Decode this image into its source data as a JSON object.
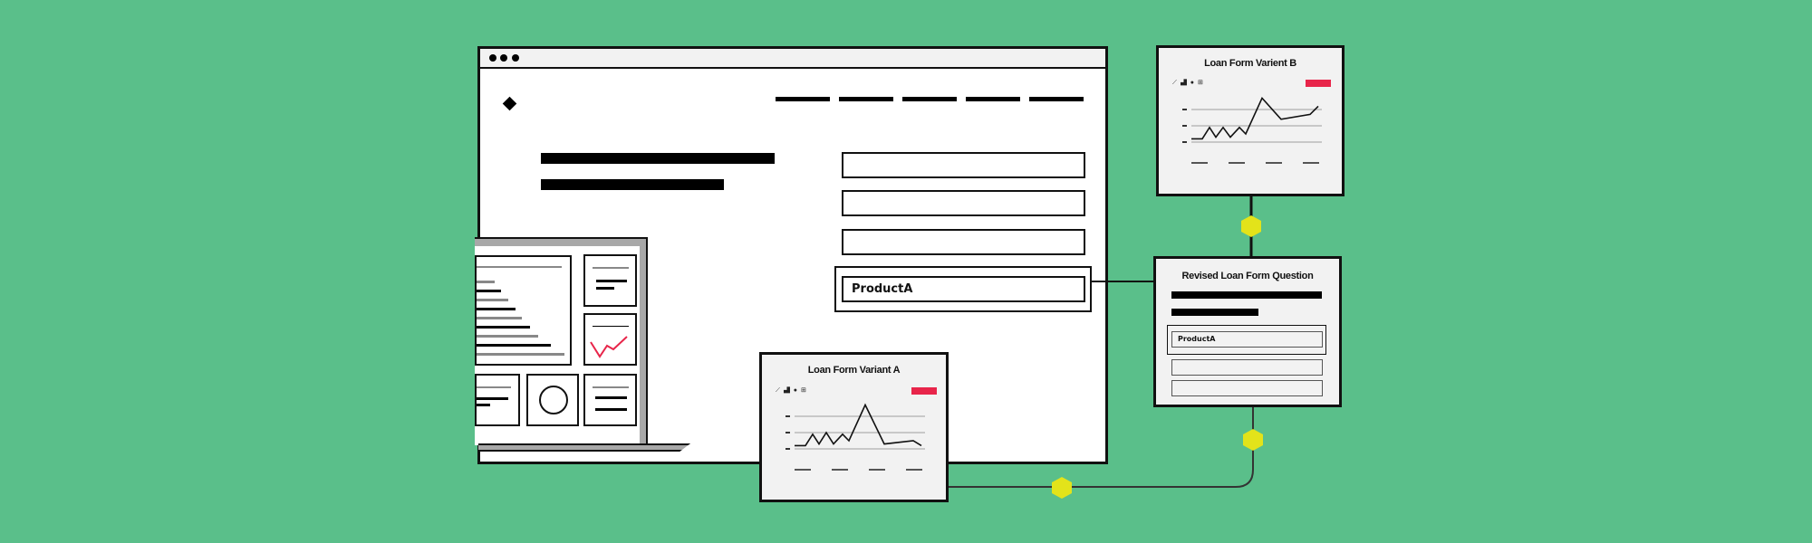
{
  "diagram": {
    "background_color": "#5ABF8A",
    "accent_red": "#E8254A",
    "connector_node_color": "#E3E31A",
    "browser_window": {
      "window_controls": [
        "dot",
        "dot",
        "dot"
      ],
      "logo_icon": "diamond-icon",
      "nav_item_count": 5,
      "form_fields": [
        {
          "value": ""
        },
        {
          "value": ""
        },
        {
          "value": ""
        },
        {
          "value": "ProductA",
          "highlighted": true
        }
      ]
    },
    "laptop_dashboard": {
      "icon": "laptop-dashboard-illustration"
    },
    "cards": {
      "variant_a": {
        "title": "Loan Form Variant A",
        "toolbar_icons": [
          "line-chart-icon",
          "bar-chart-icon",
          "pie-chart-icon",
          "grid-icon"
        ],
        "toolbar_glyphs": "⟋ ▟ ● ⊞"
      },
      "variant_b": {
        "title": "Loan Form Varient B",
        "toolbar_icons": [
          "line-chart-icon",
          "bar-chart-icon",
          "pie-chart-icon",
          "grid-icon"
        ],
        "toolbar_glyphs": "⟋ ▟ ● ⊞"
      },
      "revised": {
        "title": "Revised Loan Form Question",
        "fields": [
          {
            "value": "ProductA",
            "highlighted": true
          },
          {
            "value": ""
          },
          {
            "value": ""
          }
        ]
      }
    }
  },
  "chart_data": [
    {
      "type": "line",
      "title": "Loan Form Variant A",
      "x": [
        0,
        1,
        2,
        3,
        4,
        5,
        6,
        7,
        8,
        9,
        10,
        11
      ],
      "values": [
        3.2,
        3.2,
        3.9,
        3.3,
        4.0,
        3.3,
        3.9,
        3.5,
        5.7,
        3.3,
        3.5,
        3.2
      ],
      "ylim": [
        2,
        6
      ],
      "grid": true,
      "xlabel": "",
      "ylabel": ""
    },
    {
      "type": "line",
      "title": "Loan Form Varient B",
      "x": [
        0,
        1,
        2,
        3,
        4,
        5,
        6,
        7,
        8,
        9,
        10,
        11
      ],
      "values": [
        3.2,
        3.2,
        3.9,
        3.3,
        3.9,
        3.3,
        3.9,
        3.5,
        5.7,
        4.4,
        4.7,
        5.2
      ],
      "ylim": [
        2,
        6
      ],
      "grid": true,
      "xlabel": "",
      "ylabel": ""
    }
  ]
}
